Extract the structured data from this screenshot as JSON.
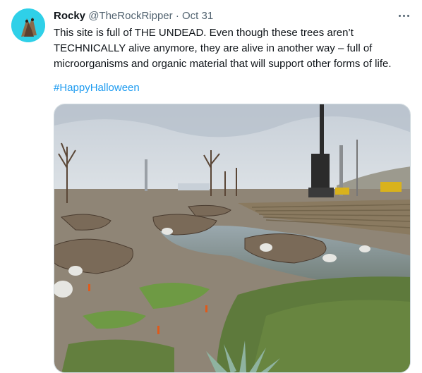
{
  "tweet": {
    "display_name": "Rocky",
    "handle": "@TheRockRipper",
    "separator": "·",
    "date": "Oct 31",
    "text": "This site is full of THE UNDEAD.  Even though these trees aren’t TECHNICALLY alive anymore, they are alive in another way – full of microorganisms and organic material that will support other forms of life.",
    "hashtag": "#HappyHalloween"
  },
  "icons": {
    "more": "more-horizontal-icon"
  },
  "colors": {
    "link": "#1d9bf0",
    "secondary_text": "#536471",
    "avatar_bg": "#2fd0e8"
  }
}
